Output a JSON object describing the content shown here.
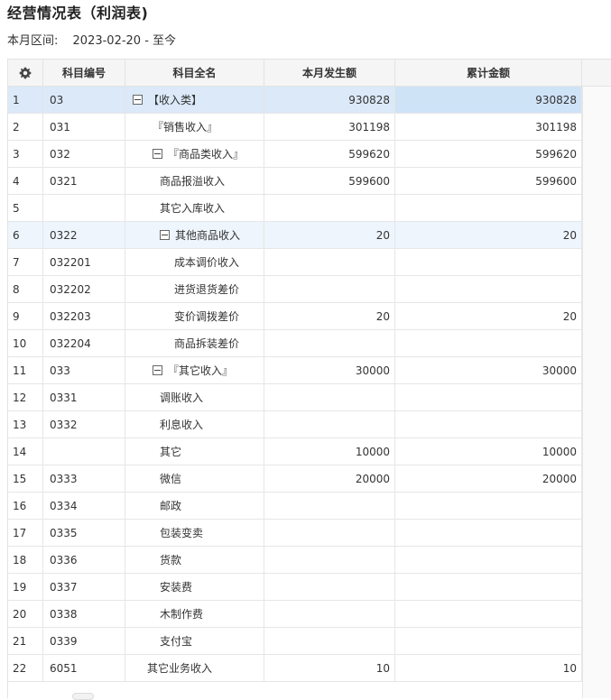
{
  "title": "经营情况表（利润表)",
  "period": {
    "label": "本月区间:",
    "value": "2023-02-20 - 至今"
  },
  "columns": {
    "code": "科目编号",
    "name": "科目全名",
    "month": "本月发生额",
    "total": "累计金额"
  },
  "icons": {
    "settings": "gear-icon",
    "collapse": "collapse-minus-icon"
  },
  "colors": {
    "selected_row": "#dbe9f8",
    "hover_row": "#eef5fc",
    "header_bg": "#f5f5f5"
  },
  "rows": [
    {
      "idx": "1",
      "code": "03",
      "name": "【收入类】",
      "month": "930828",
      "total": "930828",
      "indent": 0,
      "toggle": true,
      "selected": true
    },
    {
      "idx": "2",
      "code": "031",
      "name": "『销售收入』",
      "month": "301198",
      "total": "301198",
      "indent": 1
    },
    {
      "idx": "3",
      "code": "032",
      "name": "『商品类收入』",
      "month": "599620",
      "total": "599620",
      "indent": 1,
      "toggle": true
    },
    {
      "idx": "4",
      "code": "0321",
      "name": "商品报溢收入",
      "month": "599600",
      "total": "599600",
      "indent": 2
    },
    {
      "idx": "5",
      "code": "",
      "name": "其它入库收入",
      "month": "",
      "total": "",
      "indent": 2
    },
    {
      "idx": "6",
      "code": "0322",
      "name": "其他商品收入",
      "month": "20",
      "total": "20",
      "indent": 2,
      "toggle": true,
      "hover": true
    },
    {
      "idx": "7",
      "code": "032201",
      "name": "成本调价收入",
      "month": "",
      "total": "",
      "indent": 3
    },
    {
      "idx": "8",
      "code": "032202",
      "name": "进货退货差价",
      "month": "",
      "total": "",
      "indent": 3
    },
    {
      "idx": "9",
      "code": "032203",
      "name": "变价调拨差价",
      "month": "20",
      "total": "20",
      "indent": 3
    },
    {
      "idx": "10",
      "code": "032204",
      "name": "商品拆装差价",
      "month": "",
      "total": "",
      "indent": 3
    },
    {
      "idx": "11",
      "code": "033",
      "name": "『其它收入』",
      "month": "30000",
      "total": "30000",
      "indent": 1,
      "toggle": true
    },
    {
      "idx": "12",
      "code": "0331",
      "name": "调账收入",
      "month": "",
      "total": "",
      "indent": 2
    },
    {
      "idx": "13",
      "code": "0332",
      "name": "利息收入",
      "month": "",
      "total": "",
      "indent": 2
    },
    {
      "idx": "14",
      "code": "",
      "name": "其它",
      "month": "10000",
      "total": "10000",
      "indent": 2
    },
    {
      "idx": "15",
      "code": "0333",
      "name": "微信",
      "month": "20000",
      "total": "20000",
      "indent": 2
    },
    {
      "idx": "16",
      "code": "0334",
      "name": "邮政",
      "month": "",
      "total": "",
      "indent": 2
    },
    {
      "idx": "17",
      "code": "0335",
      "name": "包装变卖",
      "month": "",
      "total": "",
      "indent": 2
    },
    {
      "idx": "18",
      "code": "0336",
      "name": "货款",
      "month": "",
      "total": "",
      "indent": 2
    },
    {
      "idx": "19",
      "code": "0337",
      "name": "安装费",
      "month": "",
      "total": "",
      "indent": 2
    },
    {
      "idx": "20",
      "code": "0338",
      "name": "木制作费",
      "month": "",
      "total": "",
      "indent": 2
    },
    {
      "idx": "21",
      "code": "0339",
      "name": "支付宝",
      "month": "",
      "total": "",
      "indent": 2
    },
    {
      "idx": "22",
      "code": "6051",
      "name": "其它业务收入",
      "month": "10",
      "total": "10",
      "indent": 1
    }
  ]
}
